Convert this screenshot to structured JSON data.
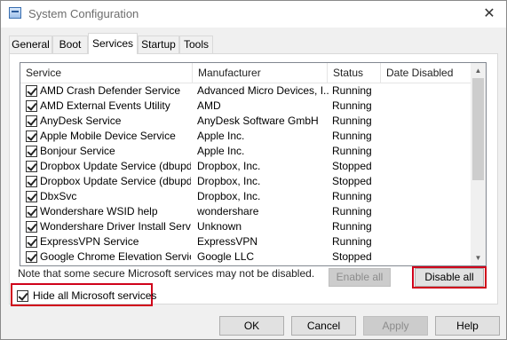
{
  "window": {
    "title": "System Configuration",
    "close_glyph": "✕",
    "icon": "system-config-icon"
  },
  "tabs": [
    {
      "label": "General",
      "active": false
    },
    {
      "label": "Boot",
      "active": false
    },
    {
      "label": "Services",
      "active": true
    },
    {
      "label": "Startup",
      "active": false
    },
    {
      "label": "Tools",
      "active": false
    }
  ],
  "columns": {
    "service": "Service",
    "manufacturer": "Manufacturer",
    "status": "Status",
    "date_disabled": "Date Disabled"
  },
  "services": [
    {
      "service": "AMD Crash Defender Service",
      "manufacturer": "Advanced Micro Devices, I...",
      "status": "Running",
      "checked": true
    },
    {
      "service": "AMD External Events Utility",
      "manufacturer": "AMD",
      "status": "Running",
      "checked": true
    },
    {
      "service": "AnyDesk Service",
      "manufacturer": "AnyDesk Software GmbH",
      "status": "Running",
      "checked": true
    },
    {
      "service": "Apple Mobile Device Service",
      "manufacturer": "Apple Inc.",
      "status": "Running",
      "checked": true
    },
    {
      "service": "Bonjour Service",
      "manufacturer": "Apple Inc.",
      "status": "Running",
      "checked": true
    },
    {
      "service": "Dropbox Update Service (dbupd...",
      "manufacturer": "Dropbox, Inc.",
      "status": "Stopped",
      "checked": true
    },
    {
      "service": "Dropbox Update Service (dbupd...",
      "manufacturer": "Dropbox, Inc.",
      "status": "Stopped",
      "checked": true
    },
    {
      "service": "DbxSvc",
      "manufacturer": "Dropbox, Inc.",
      "status": "Running",
      "checked": true
    },
    {
      "service": "Wondershare WSID help",
      "manufacturer": "wondershare",
      "status": "Running",
      "checked": true
    },
    {
      "service": "Wondershare Driver Install Servi...",
      "manufacturer": "Unknown",
      "status": "Running",
      "checked": true
    },
    {
      "service": "ExpressVPN Service",
      "manufacturer": "ExpressVPN",
      "status": "Running",
      "checked": true
    },
    {
      "service": "Google Chrome Elevation Service ...",
      "manufacturer": "Google LLC",
      "status": "Stopped",
      "checked": true
    }
  ],
  "scrollbar": {
    "up": "▲",
    "down": "▼"
  },
  "note": "Note that some secure Microsoft services may not be disabled.",
  "buttons": {
    "enable_all": "Enable all",
    "disable_all": "Disable all",
    "ok": "OK",
    "cancel": "Cancel",
    "apply": "Apply",
    "help": "Help"
  },
  "hide_ms": {
    "label": "Hide all Microsoft services",
    "checked": true
  },
  "colors": {
    "highlight": "#d0021b",
    "window_bg": "#f0f0f0"
  }
}
